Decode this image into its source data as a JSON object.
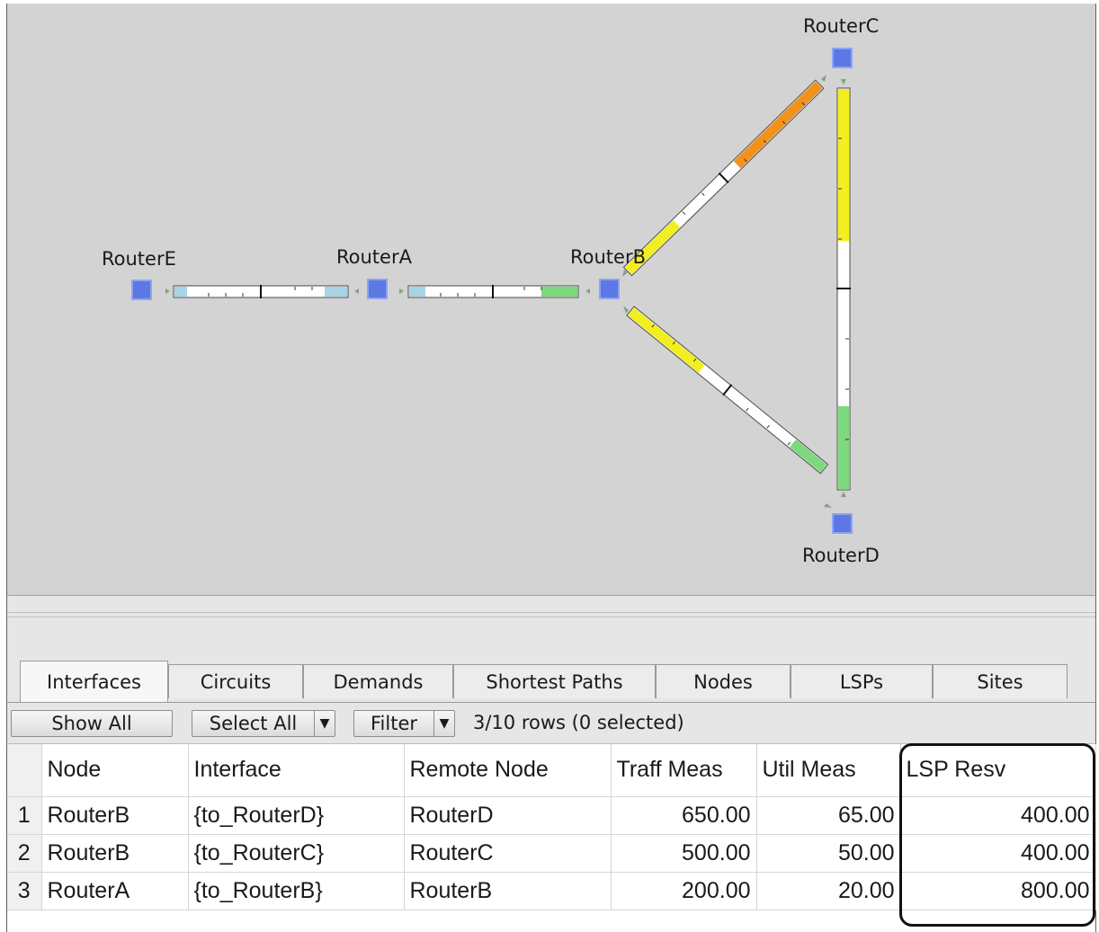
{
  "topology": {
    "nodes": [
      {
        "id": "E",
        "label": "RouterE"
      },
      {
        "id": "A",
        "label": "RouterA"
      },
      {
        "id": "B",
        "label": "RouterB"
      },
      {
        "id": "C",
        "label": "RouterC"
      },
      {
        "id": "D",
        "label": "RouterD"
      }
    ],
    "colors": {
      "background": "#d3d3d3",
      "node": "#5b78e5",
      "util_blue": "#a8d4e6",
      "util_green": "#7ed87e",
      "util_yellow": "#f2ee1f",
      "util_orange": "#f0921c",
      "link_empty": "#ffffff"
    }
  },
  "tabs": [
    {
      "label": "Interfaces",
      "active": true
    },
    {
      "label": "Circuits"
    },
    {
      "label": "Demands"
    },
    {
      "label": "Shortest Paths"
    },
    {
      "label": "Nodes"
    },
    {
      "label": "LSPs"
    },
    {
      "label": "Sites"
    }
  ],
  "toolbar": {
    "show_all": "Show All",
    "select_all": "Select All",
    "filter": "Filter",
    "dropdown_glyph": "▼",
    "row_info": "3/10 rows (0 selected)"
  },
  "table": {
    "columns": [
      "",
      "Node",
      "Interface",
      "Remote Node",
      "Traff Meas",
      "Util Meas",
      "LSP Resv"
    ],
    "rows": [
      {
        "num": "1",
        "node": "RouterB",
        "interface": "{to_RouterD}",
        "remote": "RouterD",
        "traff": "650.00",
        "util": "65.00",
        "lsp": "400.00"
      },
      {
        "num": "2",
        "node": "RouterB",
        "interface": "{to_RouterC}",
        "remote": "RouterC",
        "traff": "500.00",
        "util": "50.00",
        "lsp": "400.00"
      },
      {
        "num": "3",
        "node": "RouterA",
        "interface": "{to_RouterB}",
        "remote": "RouterB",
        "traff": "200.00",
        "util": "20.00",
        "lsp": "800.00"
      }
    ]
  }
}
